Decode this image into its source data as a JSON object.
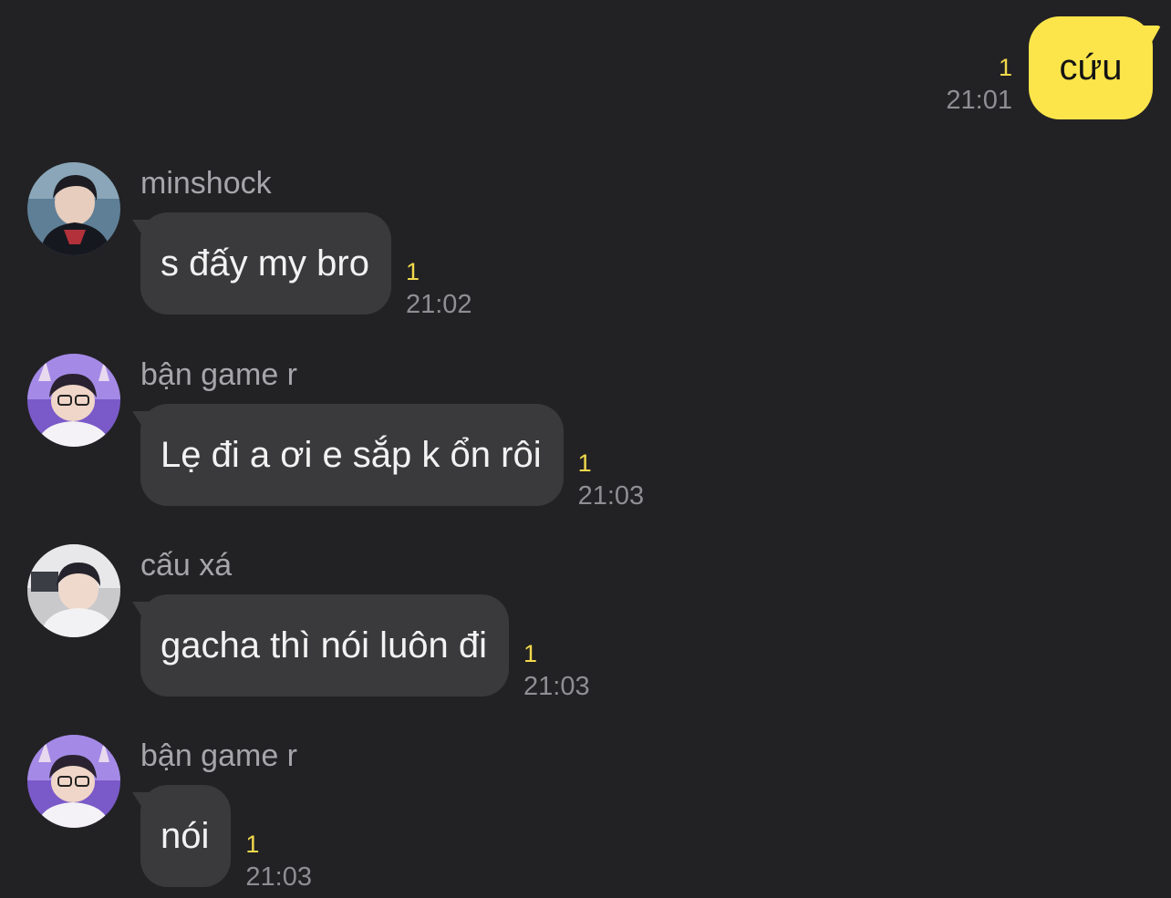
{
  "outgoing": {
    "text": "cứu",
    "read_count": "1",
    "time": "21:01"
  },
  "messages": [
    {
      "sender": "minshock",
      "text": "s đấy my bro",
      "read_count": "1",
      "time": "21:02",
      "avatar_icon": "profile-photo-icon"
    },
    {
      "sender": "bận game r",
      "text": "Lẹ đi a ơi e sắp k ổn rôi",
      "read_count": "1",
      "time": "21:03",
      "avatar_icon": "profile-photo-icon"
    },
    {
      "sender": "cấu xá",
      "text": "gacha thì nói luôn đi",
      "read_count": "1",
      "time": "21:03",
      "avatar_icon": "profile-photo-icon"
    },
    {
      "sender": "bận game r",
      "text": "nói",
      "read_count": "1",
      "time": "21:03",
      "avatar_icon": "profile-photo-icon"
    }
  ],
  "colors": {
    "background": "#222224",
    "outgoing_bubble": "#FCE54A",
    "incoming_bubble": "#3A3A3D",
    "read_count": "#F2D94B",
    "timestamp": "#8E8E93"
  }
}
